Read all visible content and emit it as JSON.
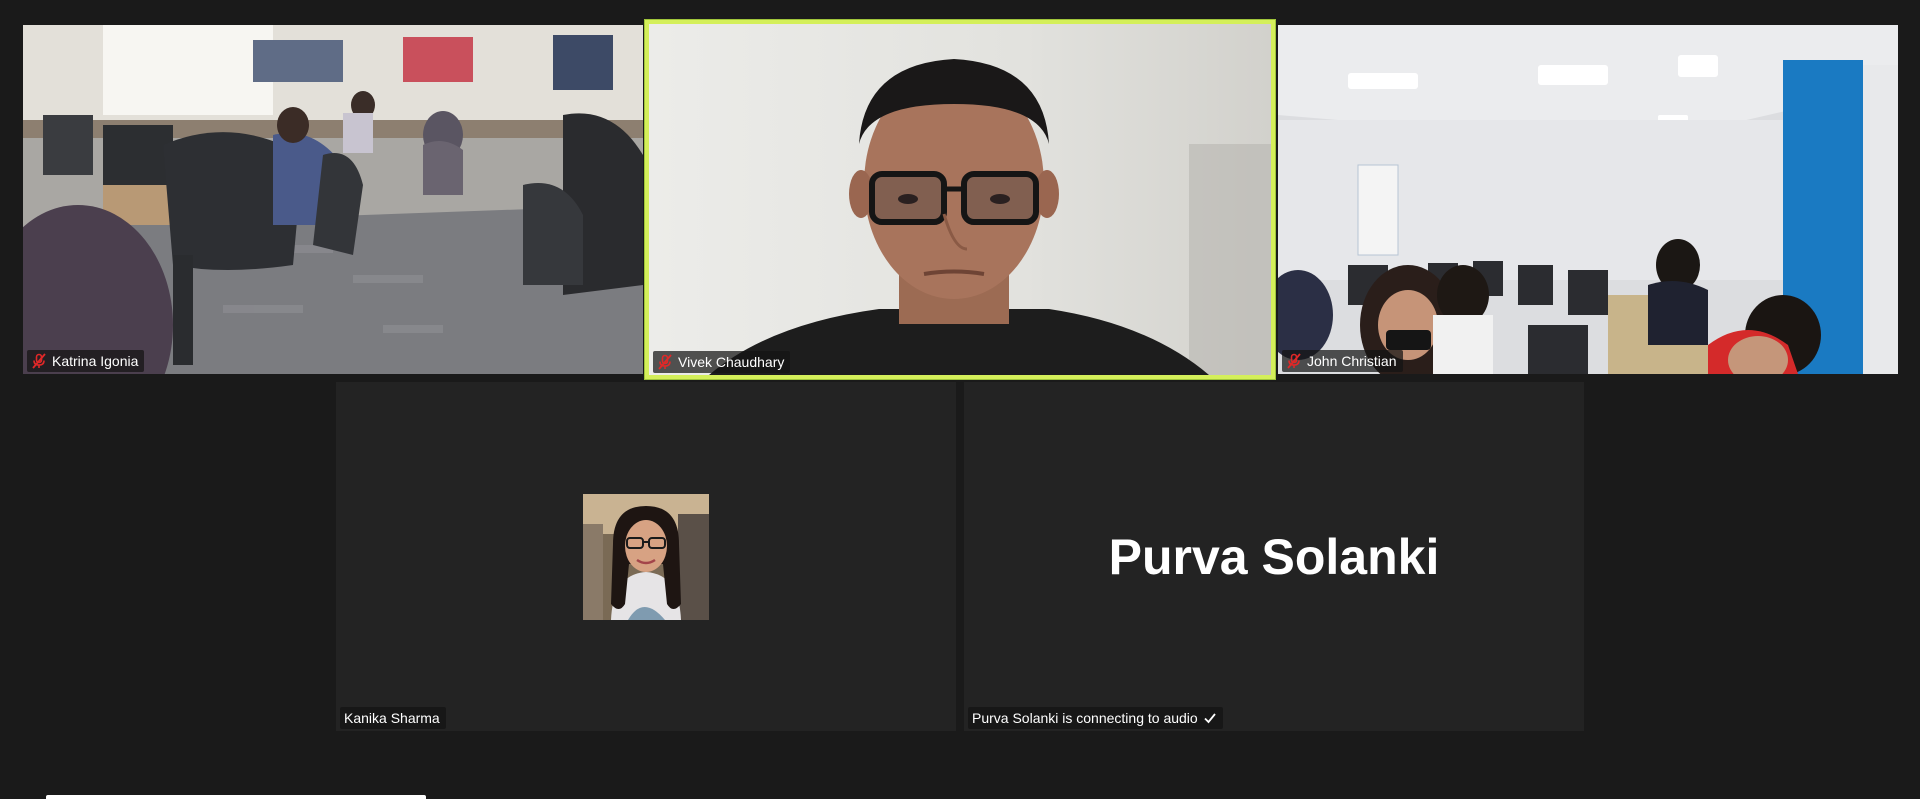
{
  "participants": {
    "katrina": {
      "name": "Katrina Igonia",
      "muted": true
    },
    "vivek": {
      "name": "Vivek Chaudhary",
      "muted": true,
      "active_speaker": true
    },
    "john": {
      "name": "John Christian",
      "muted": true
    },
    "kanika": {
      "name": "Kanika Sharma",
      "muted": false
    },
    "purva": {
      "name": "Purva Solanki",
      "display_name": "Purva Solanki",
      "status": "Purva Solanki is connecting to audio",
      "status_icon": "checkmark-icon"
    }
  },
  "colors": {
    "background": "#1a1a1a",
    "tile": "#232323",
    "active_border": "#d4ef5a",
    "mute_icon": "#e02828"
  }
}
